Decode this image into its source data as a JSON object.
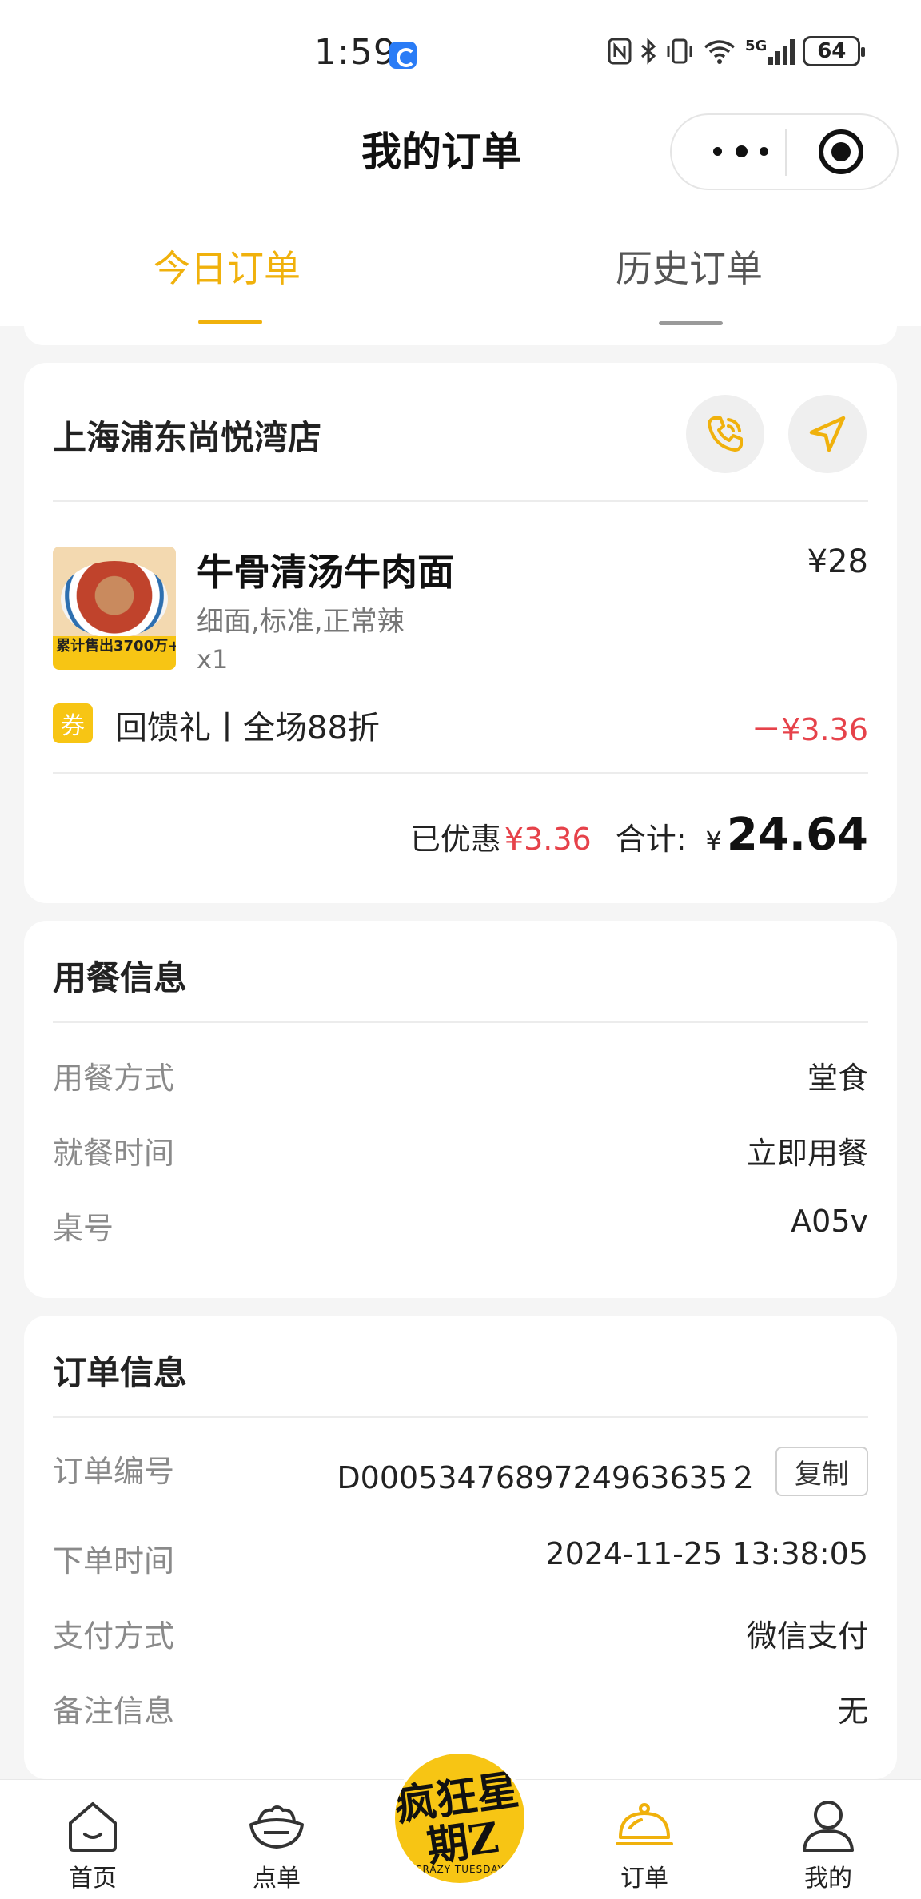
{
  "status_bar": {
    "time": "1:59",
    "network": "5G",
    "battery": "64"
  },
  "header": {
    "title": "我的订单"
  },
  "tabs": [
    {
      "label": "今日订单",
      "active": true
    },
    {
      "label": "历史订单",
      "active": false
    }
  ],
  "store": {
    "name": "上海浦东尚悦湾店"
  },
  "item": {
    "name": "牛骨清汤牛肉面",
    "spec": "细面,标准,正常辣",
    "qty": "x1",
    "price": "¥28",
    "image_banner": "累计售出3700万+碗"
  },
  "coupon": {
    "badge": "券",
    "text": "回馈礼丨全场88折",
    "amount": "－¥3.36"
  },
  "summary": {
    "saved_label": "已优惠",
    "saved_amount": "¥3.36",
    "total_label": "合计:",
    "currency": "¥",
    "total": "24.64"
  },
  "dining_info": {
    "title": "用餐信息",
    "rows": [
      {
        "label": "用餐方式",
        "value": "堂食"
      },
      {
        "label": "就餐时间",
        "value": "立即用餐"
      },
      {
        "label": "桌号",
        "value": "A05v"
      }
    ]
  },
  "order_info": {
    "title": "订单信息",
    "order_no_label": "订单编号",
    "order_no": "D0005347689724963635２",
    "copy_label": "复制",
    "rows": [
      {
        "label": "下单时间",
        "value": "2024-11-25 13:38:05"
      },
      {
        "label": "支付方式",
        "value": "微信支付"
      },
      {
        "label": "备注信息",
        "value": "无"
      }
    ]
  },
  "tabbar": {
    "home": "首页",
    "menu": "点单",
    "center_logo": "疯狂星期Z",
    "center_logo_sub": "CRAZY TUESDAY",
    "order": "订单",
    "mine": "我的"
  },
  "colors": {
    "accent": "#f0b10c",
    "discount_red": "#e6424a",
    "background": "#f5f5f5"
  }
}
